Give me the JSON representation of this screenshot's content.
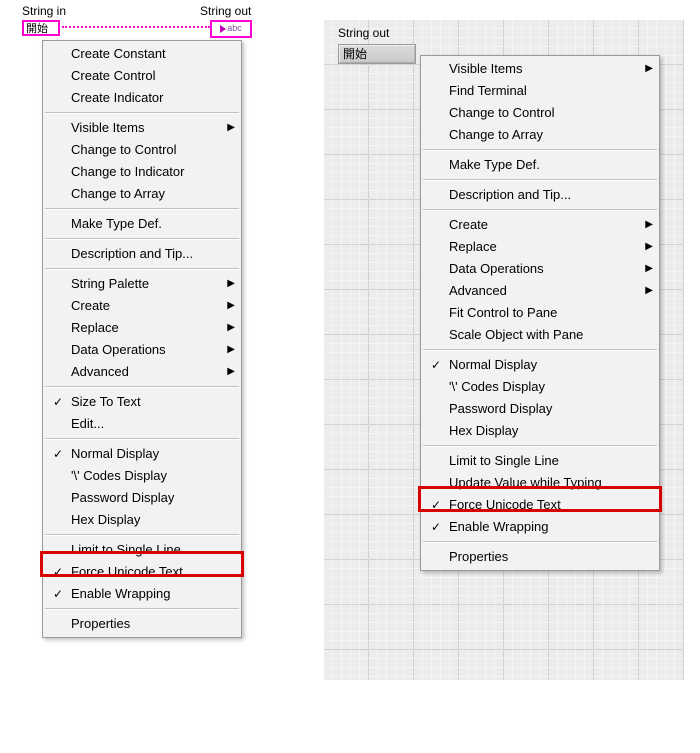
{
  "block_diagram": {
    "string_in_label": "String in",
    "string_out_label": "String out",
    "string_const_value": "開始",
    "indicator_text": "abc"
  },
  "front_panel": {
    "control_label": "String out",
    "control_value": "開始"
  },
  "menu_bd": {
    "items": [
      {
        "label": "Create Constant",
        "hasSub": false,
        "checked": false
      },
      {
        "label": "Create Control",
        "hasSub": false,
        "checked": false
      },
      {
        "label": "Create Indicator",
        "hasSub": false,
        "checked": false
      },
      {
        "sep": true
      },
      {
        "label": "Visible Items",
        "hasSub": true,
        "checked": false
      },
      {
        "label": "Change to Control",
        "hasSub": false,
        "checked": false
      },
      {
        "label": "Change to Indicator",
        "hasSub": false,
        "checked": false
      },
      {
        "label": "Change to Array",
        "hasSub": false,
        "checked": false
      },
      {
        "sep": true
      },
      {
        "label": "Make Type Def.",
        "hasSub": false,
        "checked": false
      },
      {
        "sep": true
      },
      {
        "label": "Description and Tip...",
        "hasSub": false,
        "checked": false
      },
      {
        "sep": true
      },
      {
        "label": "String Palette",
        "hasSub": true,
        "checked": false
      },
      {
        "label": "Create",
        "hasSub": true,
        "checked": false
      },
      {
        "label": "Replace",
        "hasSub": true,
        "checked": false
      },
      {
        "label": "Data Operations",
        "hasSub": true,
        "checked": false
      },
      {
        "label": "Advanced",
        "hasSub": true,
        "checked": false
      },
      {
        "sep": true
      },
      {
        "label": "Size To Text",
        "hasSub": false,
        "checked": true
      },
      {
        "label": "Edit...",
        "hasSub": false,
        "checked": false
      },
      {
        "sep": true
      },
      {
        "label": "Normal Display",
        "hasSub": false,
        "checked": true
      },
      {
        "label": "'\\' Codes Display",
        "hasSub": false,
        "checked": false
      },
      {
        "label": "Password Display",
        "hasSub": false,
        "checked": false
      },
      {
        "label": "Hex Display",
        "hasSub": false,
        "checked": false
      },
      {
        "sep": true
      },
      {
        "label": "Limit to Single Line",
        "hasSub": false,
        "checked": false
      },
      {
        "label": "Force Unicode Text",
        "hasSub": false,
        "checked": true,
        "hl": true
      },
      {
        "label": "Enable Wrapping",
        "hasSub": false,
        "checked": true
      },
      {
        "sep": true
      },
      {
        "label": "Properties",
        "hasSub": false,
        "checked": false
      }
    ]
  },
  "menu_fp": {
    "items": [
      {
        "label": "Visible Items",
        "hasSub": true,
        "checked": false
      },
      {
        "label": "Find Terminal",
        "hasSub": false,
        "checked": false
      },
      {
        "label": "Change to Control",
        "hasSub": false,
        "checked": false
      },
      {
        "label": "Change to Array",
        "hasSub": false,
        "checked": false
      },
      {
        "sep": true
      },
      {
        "label": "Make Type Def.",
        "hasSub": false,
        "checked": false
      },
      {
        "sep": true
      },
      {
        "label": "Description and Tip...",
        "hasSub": false,
        "checked": false
      },
      {
        "sep": true
      },
      {
        "label": "Create",
        "hasSub": true,
        "checked": false
      },
      {
        "label": "Replace",
        "hasSub": true,
        "checked": false
      },
      {
        "label": "Data Operations",
        "hasSub": true,
        "checked": false
      },
      {
        "label": "Advanced",
        "hasSub": true,
        "checked": false
      },
      {
        "label": "Fit Control to Pane",
        "hasSub": false,
        "checked": false
      },
      {
        "label": "Scale Object with Pane",
        "hasSub": false,
        "checked": false
      },
      {
        "sep": true
      },
      {
        "label": "Normal Display",
        "hasSub": false,
        "checked": true
      },
      {
        "label": "'\\' Codes Display",
        "hasSub": false,
        "checked": false
      },
      {
        "label": "Password Display",
        "hasSub": false,
        "checked": false
      },
      {
        "label": "Hex Display",
        "hasSub": false,
        "checked": false
      },
      {
        "sep": true
      },
      {
        "label": "Limit to Single Line",
        "hasSub": false,
        "checked": false
      },
      {
        "label": "Update Value while Typing",
        "hasSub": false,
        "checked": false
      },
      {
        "label": "Force Unicode Text",
        "hasSub": false,
        "checked": true,
        "hl": true
      },
      {
        "label": "Enable Wrapping",
        "hasSub": false,
        "checked": true
      },
      {
        "sep": true
      },
      {
        "label": "Properties",
        "hasSub": false,
        "checked": false
      }
    ]
  }
}
